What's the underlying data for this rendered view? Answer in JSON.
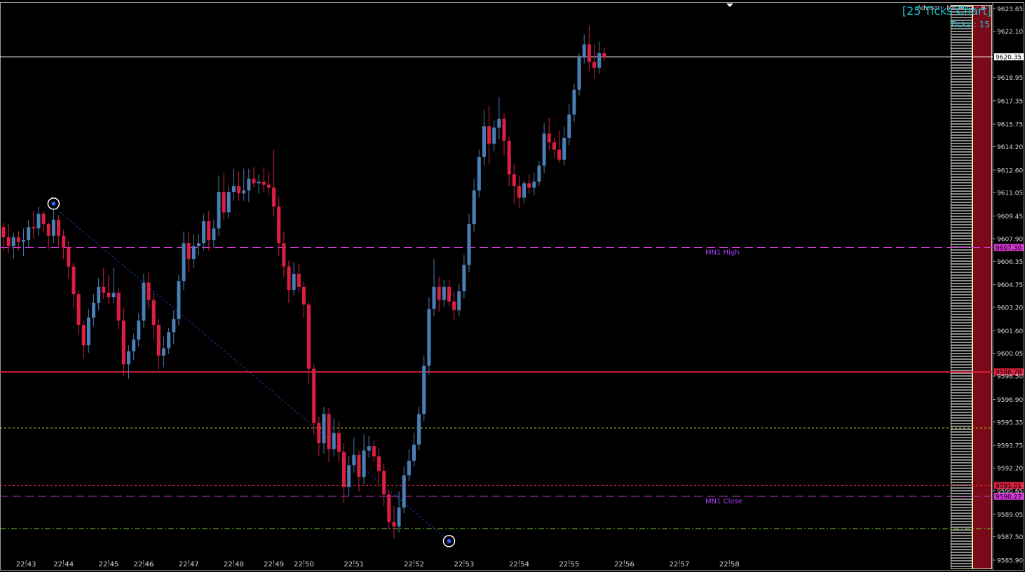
{
  "header": {
    "title": "[25 Ticks Chart]",
    "ticks_label": "Ticks : 15",
    "advisor_label": "Advisor · Mo Tema · ⊗"
  },
  "colors": {
    "background": "#000000",
    "bull": "#4a7fb5",
    "bear": "#dc1e42",
    "mn_line": "#d535d5",
    "red_level": "#e0203f",
    "current_price_line": "#ffffff",
    "yellow_level": "#c8d62a",
    "green_level": "#7fcf2e",
    "trend_line": "#2535a8",
    "profile_bar": "#7a0a1a"
  },
  "chart_data": {
    "type": "candlestick",
    "title": "[25 Ticks Chart]",
    "ylim": [
      9585.9,
      9624.0
    ],
    "y_ticks": [
      "9623.65",
      "9622.10",
      "9618.95",
      "9617.35",
      "9615.75",
      "9614.20",
      "9612.60",
      "9611.05",
      "9609.45",
      "9607.90",
      "9606.35",
      "9604.75",
      "9603.20",
      "9601.60",
      "9600.05",
      "9598.50",
      "9596.90",
      "9595.35",
      "9593.75",
      "9592.20",
      "9590.65",
      "9589.05",
      "9587.50",
      "9585.90"
    ],
    "x_ticks": [
      {
        "label": "22:43",
        "index": 4.5
      },
      {
        "label": "22:44",
        "index": 12
      },
      {
        "label": "22:45",
        "index": 21
      },
      {
        "label": "22:46",
        "index": 28
      },
      {
        "label": "22:47",
        "index": 37
      },
      {
        "label": "22:48",
        "index": 46
      },
      {
        "label": "22:49",
        "index": 54
      },
      {
        "label": "22:50",
        "index": 60
      },
      {
        "label": "22:51",
        "index": 70
      },
      {
        "label": "22:52",
        "index": 82
      },
      {
        "label": "22:53",
        "index": 92
      },
      {
        "label": "22:54",
        "index": 103
      },
      {
        "label": "22:55",
        "index": 113
      },
      {
        "label": "22:56",
        "index": 124
      },
      {
        "label": "22:57",
        "index": 135
      },
      {
        "label": "22:58",
        "index": 145
      }
    ],
    "candles": [
      [
        9608.7,
        9609.0,
        9607.1,
        9608.0
      ],
      [
        9608.0,
        9608.9,
        9606.9,
        9607.4
      ],
      [
        9607.4,
        9608.3,
        9606.5,
        9608.0
      ],
      [
        9608.0,
        9608.4,
        9607.1,
        9607.7
      ],
      [
        9607.7,
        9608.6,
        9606.7,
        9607.8
      ],
      [
        9607.8,
        9609.2,
        9607.3,
        9608.7
      ],
      [
        9608.7,
        9609.8,
        9607.9,
        9608.6
      ],
      [
        9608.6,
        9610.1,
        9608.1,
        9609.6
      ],
      [
        9609.6,
        9609.8,
        9608.4,
        9608.9
      ],
      [
        9608.9,
        9609.0,
        9607.2,
        9608.1
      ],
      [
        9608.1,
        9610.2,
        9607.6,
        9609.2
      ],
      [
        9609.2,
        9609.5,
        9607.4,
        9608.1
      ],
      [
        9608.1,
        9608.5,
        9606.5,
        9607.3
      ],
      [
        9607.3,
        9607.7,
        9605.2,
        9606.0
      ],
      [
        9606.0,
        9606.3,
        9603.2,
        9604.1
      ],
      [
        9604.1,
        9604.4,
        9601.3,
        9602.0
      ],
      [
        9602.0,
        9602.3,
        9599.7,
        9600.6
      ],
      [
        9600.6,
        9603.1,
        9600.1,
        9602.5
      ],
      [
        9602.5,
        9604.1,
        9601.9,
        9603.5
      ],
      [
        9603.5,
        9605.2,
        9603.0,
        9604.6
      ],
      [
        9604.6,
        9605.9,
        9603.8,
        9604.2
      ],
      [
        9604.2,
        9605.4,
        9603.4,
        9603.9
      ],
      [
        9603.9,
        9605.9,
        9603.5,
        9604.2
      ],
      [
        9604.2,
        9604.5,
        9601.7,
        9602.3
      ],
      [
        9602.3,
        9603.2,
        9598.5,
        9599.3
      ],
      [
        9599.3,
        9600.6,
        9598.3,
        9600.2
      ],
      [
        9600.2,
        9601.4,
        9599.6,
        9601.0
      ],
      [
        9601.0,
        9602.8,
        9600.5,
        9602.3
      ],
      [
        9602.3,
        9605.5,
        9601.8,
        9604.9
      ],
      [
        9604.9,
        9605.6,
        9603.1,
        9603.7
      ],
      [
        9603.7,
        9604.2,
        9601.0,
        9602.0
      ],
      [
        9602.0,
        9602.4,
        9598.9,
        9599.9
      ],
      [
        9599.9,
        9601.2,
        9599.1,
        9600.4
      ],
      [
        9600.4,
        9601.8,
        9600.0,
        9601.5
      ],
      [
        9601.5,
        9603.0,
        9600.7,
        9602.4
      ],
      [
        9602.4,
        9605.4,
        9602.0,
        9605.0
      ],
      [
        9605.0,
        9608.4,
        9604.4,
        9607.6
      ],
      [
        9607.6,
        9608.3,
        9605.6,
        9606.5
      ],
      [
        9606.5,
        9608.2,
        9605.9,
        9607.4
      ],
      [
        9607.4,
        9608.2,
        9606.8,
        9607.6
      ],
      [
        9607.6,
        9609.6,
        9607.1,
        9609.1
      ],
      [
        9609.1,
        9609.8,
        9607.1,
        9607.8
      ],
      [
        9607.8,
        9609.2,
        9607.3,
        9608.6
      ],
      [
        9608.6,
        9612.2,
        9608.1,
        9611.1
      ],
      [
        9611.1,
        9612.4,
        9609.2,
        9609.7
      ],
      [
        9609.7,
        9611.5,
        9609.3,
        9611.1
      ],
      [
        9611.1,
        9612.7,
        9610.5,
        9611.5
      ],
      [
        9611.5,
        9612.5,
        9610.5,
        9611.0
      ],
      [
        9611.0,
        9612.7,
        9610.5,
        9611.2
      ],
      [
        9611.2,
        9612.7,
        9610.4,
        9612.0
      ],
      [
        9612.0,
        9612.8,
        9611.4,
        9611.7
      ],
      [
        9611.7,
        9612.3,
        9611.0,
        9611.8
      ],
      [
        9611.8,
        9612.8,
        9611.1,
        9611.6
      ],
      [
        9611.6,
        9612.5,
        9610.9,
        9611.4
      ],
      [
        9611.4,
        9614.0,
        9609.4,
        9610.1
      ],
      [
        9610.1,
        9610.8,
        9606.7,
        9607.6
      ],
      [
        9607.6,
        9608.4,
        9605.3,
        9606.0
      ],
      [
        9606.0,
        9606.4,
        9603.5,
        9604.4
      ],
      [
        9604.4,
        9606.3,
        9604.0,
        9605.5
      ],
      [
        9605.5,
        9606.2,
        9604.2,
        9604.6
      ],
      [
        9604.6,
        9605.0,
        9602.5,
        9603.4
      ],
      [
        9603.4,
        9603.6,
        9598.0,
        9599.0
      ],
      [
        9599.0,
        9599.3,
        9594.5,
        9595.3
      ],
      [
        9595.3,
        9595.7,
        9593.0,
        9593.9
      ],
      [
        9593.9,
        9596.4,
        9593.2,
        9595.9
      ],
      [
        9595.9,
        9596.3,
        9592.6,
        9593.5
      ],
      [
        9593.5,
        9595.6,
        9593.0,
        9594.6
      ],
      [
        9594.6,
        9595.4,
        9592.6,
        9593.3
      ],
      [
        9593.3,
        9593.9,
        9589.8,
        9590.9
      ],
      [
        9590.9,
        9593.0,
        9590.3,
        9592.4
      ],
      [
        9592.4,
        9594.3,
        9591.9,
        9593.1
      ],
      [
        9593.1,
        9593.4,
        9590.6,
        9591.6
      ],
      [
        9591.6,
        9594.5,
        9591.1,
        9593.4
      ],
      [
        9593.4,
        9594.4,
        9592.9,
        9593.7
      ],
      [
        9593.7,
        9594.1,
        9592.6,
        9593.0
      ],
      [
        9593.0,
        9593.6,
        9591.1,
        9592.0
      ],
      [
        9592.0,
        9592.5,
        9589.6,
        9590.4
      ],
      [
        9590.4,
        9590.7,
        9588.0,
        9588.5
      ],
      [
        9588.5,
        9589.6,
        9587.4,
        9588.2
      ],
      [
        9588.2,
        9590.6,
        9587.8,
        9589.5
      ],
      [
        9589.5,
        9592.3,
        9589.1,
        9591.7
      ],
      [
        9591.7,
        9593.5,
        9591.3,
        9592.7
      ],
      [
        9592.7,
        9594.6,
        9592.3,
        9593.8
      ],
      [
        9593.8,
        9596.4,
        9593.4,
        9595.9
      ],
      [
        9595.9,
        9599.9,
        9595.4,
        9599.2
      ],
      [
        9599.2,
        9603.9,
        9598.6,
        9603.1
      ],
      [
        9603.1,
        9606.5,
        9602.6,
        9604.6
      ],
      [
        9604.6,
        9605.3,
        9602.9,
        9603.7
      ],
      [
        9603.7,
        9605.1,
        9603.2,
        9604.6
      ],
      [
        9604.6,
        9605.1,
        9603.3,
        9603.6
      ],
      [
        9603.6,
        9604.3,
        9602.3,
        9603.0
      ],
      [
        9603.0,
        9604.8,
        9602.6,
        9604.3
      ],
      [
        9604.3,
        9606.8,
        9603.8,
        9606.1
      ],
      [
        9606.1,
        9609.6,
        9605.6,
        9608.9
      ],
      [
        9608.9,
        9612.0,
        9608.4,
        9611.2
      ],
      [
        9611.2,
        9614.0,
        9610.7,
        9613.5
      ],
      [
        9613.5,
        9616.7,
        9612.9,
        9615.6
      ],
      [
        9615.6,
        9617.0,
        9613.0,
        9614.4
      ],
      [
        9614.4,
        9616.0,
        9613.9,
        9615.5
      ],
      [
        9615.5,
        9617.6,
        9614.7,
        9616.1
      ],
      [
        9616.1,
        9616.5,
        9613.6,
        9614.6
      ],
      [
        9614.6,
        9614.9,
        9611.5,
        9612.3
      ],
      [
        9612.3,
        9613.0,
        9610.3,
        9611.5
      ],
      [
        9611.5,
        9612.2,
        9610.0,
        9610.7
      ],
      [
        9610.7,
        9611.9,
        9610.3,
        9611.7
      ],
      [
        9611.7,
        9612.3,
        9611.0,
        9611.4
      ],
      [
        9611.4,
        9612.4,
        9610.9,
        9611.8
      ],
      [
        9611.8,
        9613.2,
        9611.5,
        9612.9
      ],
      [
        9612.9,
        9615.8,
        9612.4,
        9615.1
      ],
      [
        9615.1,
        9616.2,
        9614.0,
        9614.5
      ],
      [
        9614.5,
        9614.8,
        9613.4,
        9614.0
      ],
      [
        9614.0,
        9615.3,
        9613.1,
        9613.3
      ],
      [
        9613.3,
        9615.6,
        9612.9,
        9614.8
      ],
      [
        9614.8,
        9617.1,
        9614.3,
        9616.4
      ],
      [
        9616.4,
        9618.5,
        9615.9,
        9618.1
      ],
      [
        9618.1,
        9620.6,
        9617.7,
        9620.3
      ],
      [
        9620.3,
        9621.9,
        9619.9,
        9621.2
      ],
      [
        9621.2,
        9622.5,
        9619.4,
        9620.0
      ],
      [
        9620.0,
        9621.2,
        9618.9,
        9619.6
      ],
      [
        9619.6,
        9621.4,
        9619.2,
        9620.6
      ],
      [
        9620.6,
        9621.0,
        9620.1,
        9620.35
      ]
    ],
    "horizontal_levels": [
      {
        "price": 9620.35,
        "style": "current",
        "label": "9620.35"
      },
      {
        "price": 9607.3,
        "style": "mn-high",
        "label": "9607.30",
        "text": "MN1 High"
      },
      {
        "price": 9598.78,
        "style": "red",
        "label": "9598.78"
      },
      {
        "price": 9594.95,
        "style": "yellow"
      },
      {
        "price": 9591.01,
        "style": "red-dash",
        "label": "9591.01"
      },
      {
        "price": 9590.27,
        "style": "mn-close",
        "label": "9590.27",
        "text": "MN1 Close"
      },
      {
        "price": 9588.05,
        "style": "green"
      }
    ],
    "trend_line": {
      "from_index": 10,
      "from_price": 9610.1,
      "to_index": 89,
      "to_price": 9587.2
    },
    "markers": [
      {
        "index": 10,
        "price": 9610.3,
        "name": "trend-start-marker"
      },
      {
        "index": 89,
        "price": 9587.2,
        "name": "trend-end-marker"
      }
    ]
  }
}
